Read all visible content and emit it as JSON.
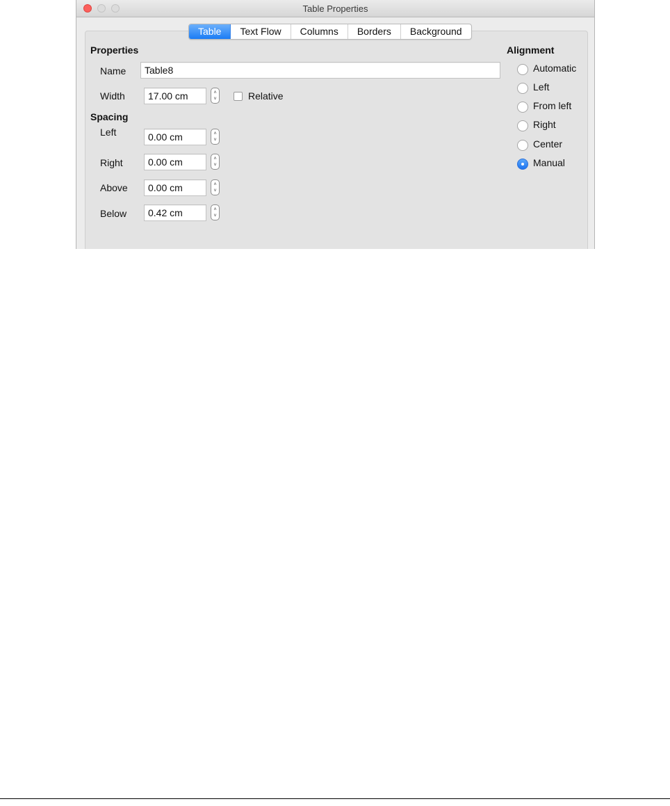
{
  "window": {
    "title": "Table Properties"
  },
  "tabs": [
    "Table",
    "Text Flow",
    "Columns",
    "Borders",
    "Background"
  ],
  "active_tab": "Table",
  "properties": {
    "header": "Properties",
    "name_label": "Name",
    "name_value": "Table8",
    "width_label": "Width",
    "width_value": "17.00 cm",
    "relative_label": "Relative",
    "relative_checked": false
  },
  "spacing": {
    "header": "Spacing",
    "left_label": "Left",
    "left_value": "0.00 cm",
    "right_label": "Right",
    "right_value": "0.00 cm",
    "above_label": "Above",
    "above_value": "0.00 cm",
    "below_label": "Below",
    "below_value": "0.42 cm"
  },
  "alignment": {
    "header": "Alignment",
    "options": [
      "Automatic",
      "Left",
      "From left",
      "Right",
      "Center",
      "Manual"
    ],
    "selected": "Manual"
  },
  "colors": {
    "accent": "#1b7cf5",
    "close_button": "#fc605c"
  }
}
